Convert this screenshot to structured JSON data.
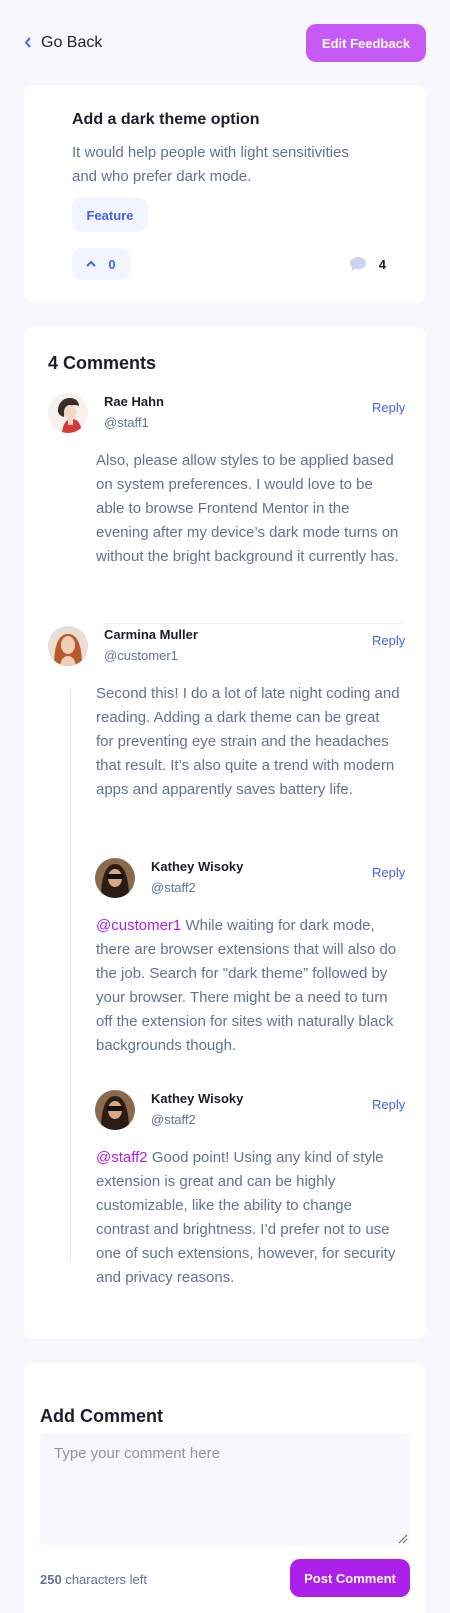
{
  "nav": {
    "back_label": "Go Back",
    "edit_label": "Edit Feedback"
  },
  "feedback": {
    "title": "Add a dark theme option",
    "description": "It would help people with light sensitivities and who prefer dark mode.",
    "tag": "Feature",
    "upvotes": "0",
    "comment_count": "4"
  },
  "comments_section": {
    "heading": "4 Comments",
    "comments": [
      {
        "name": "Rae Hahn",
        "handle": "@staff1",
        "reply_label": "Reply",
        "text": "Also, please allow styles to be applied based on system preferences. I would love to be able to browse Frontend Mentor in the evening after my device’s dark mode turns on without the bright background it currently has."
      },
      {
        "name": "Carmina Muller",
        "handle": "@customer1",
        "reply_label": "Reply",
        "text": "Second this! I do a lot of late night coding and reading. Adding a dark theme can be great for preventing eye strain and the headaches that result. It’s also quite a trend with modern apps and apparently saves battery life."
      },
      {
        "name": "Kathey Wisoky",
        "handle": "@staff2",
        "reply_label": "Reply",
        "mention": "@customer1",
        "text": "While waiting for dark mode, there are browser extensions that will also do the job. Search for \"dark theme” followed by your browser. There might be a need to turn off the extension for sites with naturally black backgrounds though."
      },
      {
        "name": "Kathey Wisoky",
        "handle": "@staff2",
        "reply_label": "Reply",
        "mention": "@staff2",
        "text": "Good point! Using any kind of style extension is great and can be highly customizable, like the ability to change contrast and brightness. I’d prefer not to use one of such extensions, however, for security and privacy reasons."
      }
    ]
  },
  "add_comment": {
    "title": "Add Comment",
    "placeholder": "Type your comment here",
    "chars_left_count": "250",
    "chars_left_label": "characters left",
    "post_label": "Post Comment"
  },
  "colors": {
    "page_bg": "#f7f8fd",
    "accent_purple": "#ad1fea",
    "edit_purple": "#c75af6",
    "blue": "#4661e6",
    "navy": "#3a4374",
    "grey": "#647196"
  }
}
